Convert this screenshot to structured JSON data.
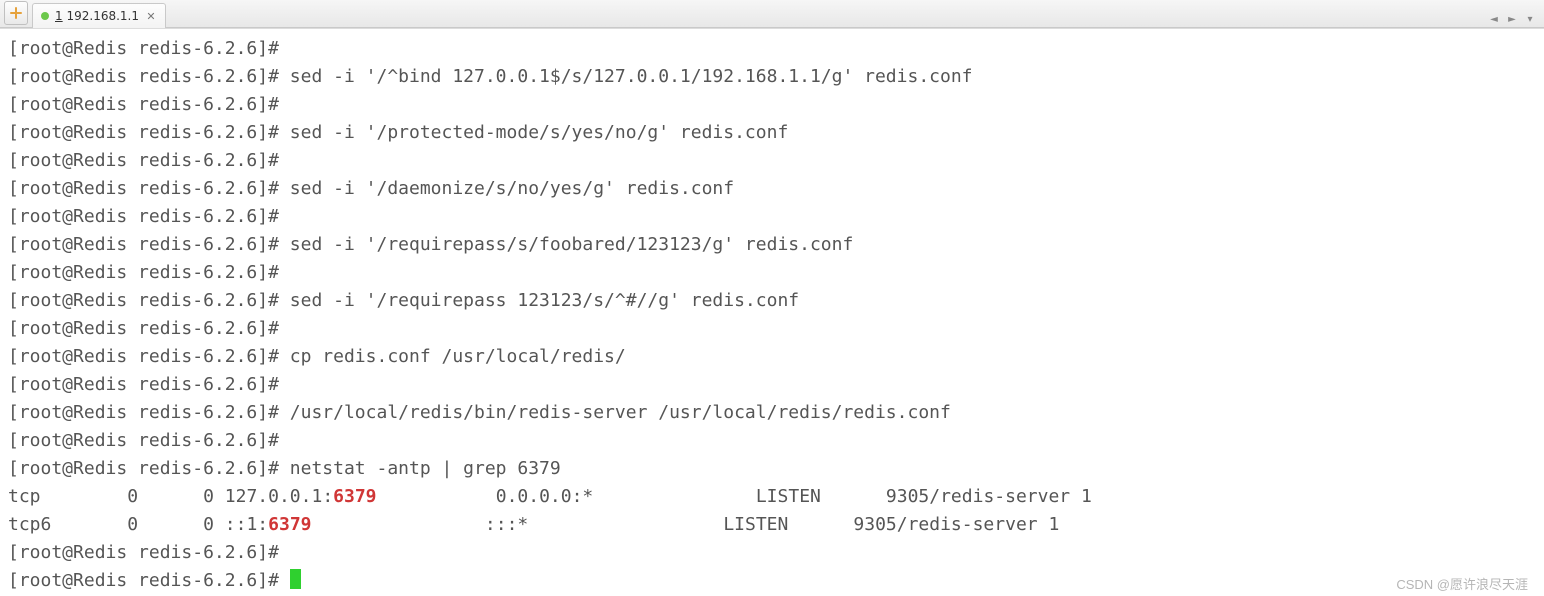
{
  "tab": {
    "index": "1",
    "title": "192.168.1.1"
  },
  "prompt": "[root@Redis redis-6.2.6]#",
  "lines": {
    "l0": "",
    "l1": "sed -i '/^bind 127.0.0.1$/s/127.0.0.1/192.168.1.1/g' redis.conf",
    "l2": "",
    "l3": "sed -i '/protected-mode/s/yes/no/g' redis.conf",
    "l4": "",
    "l5": "sed -i '/daemonize/s/no/yes/g' redis.conf",
    "l6": "",
    "l7": "sed -i '/requirepass/s/foobared/123123/g' redis.conf",
    "l8": "",
    "l9": "sed -i '/requirepass 123123/s/^#//g' redis.conf",
    "l10": "",
    "l11": "cp redis.conf /usr/local/redis/",
    "l12": "",
    "l13": "/usr/local/redis/bin/redis-server /usr/local/redis/redis.conf",
    "l14": "",
    "l15": "netstat -antp | grep 6379"
  },
  "netstat": {
    "row1": {
      "proto": "tcp",
      "recv": "0",
      "send": "0",
      "local_pre": "127.0.0.1:",
      "port": "6379",
      "foreign": "0.0.0.0:*",
      "state": "LISTEN",
      "pid": "9305/redis-server 1"
    },
    "row2": {
      "proto": "tcp6",
      "recv": "0",
      "send": "0",
      "local_pre": "::1:",
      "port": "6379",
      "foreign": ":::*",
      "state": "LISTEN",
      "pid": "9305/redis-server 1"
    }
  },
  "watermark": "CSDN @愿许浪尽天涯"
}
